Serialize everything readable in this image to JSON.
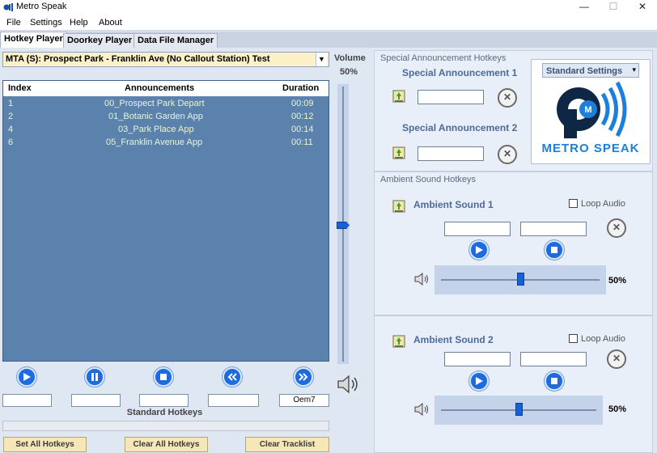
{
  "window": {
    "title": "Metro Speak",
    "controls": [
      "—",
      "☐",
      "✕"
    ]
  },
  "menu": [
    "File",
    "Settings",
    "Help",
    "About"
  ],
  "tabs": [
    "Hotkey Player",
    "Doorkey Player",
    "Data File Manager"
  ],
  "track_select": {
    "value": "MTA (S): Prospect Park - Franklin Ave (No Callout Station) Test"
  },
  "table": {
    "columns": [
      "Index",
      "Announcements",
      "Duration"
    ],
    "rows": [
      {
        "index": "1",
        "name": "00_Prospect Park Depart",
        "duration": "00:09"
      },
      {
        "index": "2",
        "name": "01_Botanic Garden App",
        "duration": "00:12"
      },
      {
        "index": "4",
        "name": "03_Park Place App",
        "duration": "00:14"
      },
      {
        "index": "6",
        "name": "05_Franklin Avenue App",
        "duration": "00:11"
      }
    ]
  },
  "controls": {
    "hotkeys": [
      "",
      "",
      "",
      "",
      "Oem7"
    ],
    "section_label": "Standard Hotkeys"
  },
  "bottom_buttons": [
    "Set All Hotkeys",
    "Clear All Hotkeys",
    "Clear Tracklist"
  ],
  "volume": {
    "label": "Volume",
    "value_text": "50%",
    "level": 0.5
  },
  "special": {
    "header": "Special Announcement Hotkeys",
    "items": [
      {
        "label": "Special Announcement 1",
        "hotkey": ""
      },
      {
        "label": "Special Announcement 2",
        "hotkey": ""
      }
    ]
  },
  "settings_select": {
    "value": "Standard Settings"
  },
  "logo": {
    "text": "METRO SPEAK",
    "letter": "M"
  },
  "ambient": {
    "header": "Ambient Sound Hotkeys",
    "items": [
      {
        "label": "Ambient Sound 1",
        "loop_label": "Loop Audio",
        "loop": false,
        "hotkey1": "",
        "hotkey2": "",
        "volume_text": "50%",
        "volume": 0.5
      },
      {
        "label": "Ambient Sound 2",
        "loop_label": "Loop Audio",
        "loop": false,
        "hotkey1": "",
        "hotkey2": "",
        "volume_text": "50%",
        "volume": 0.5
      }
    ]
  },
  "colors": {
    "accent": "#1e6be0",
    "table_bg": "#5b82ac",
    "row_text": "#e8f4d8",
    "button_bg": "#f5e7b8"
  }
}
